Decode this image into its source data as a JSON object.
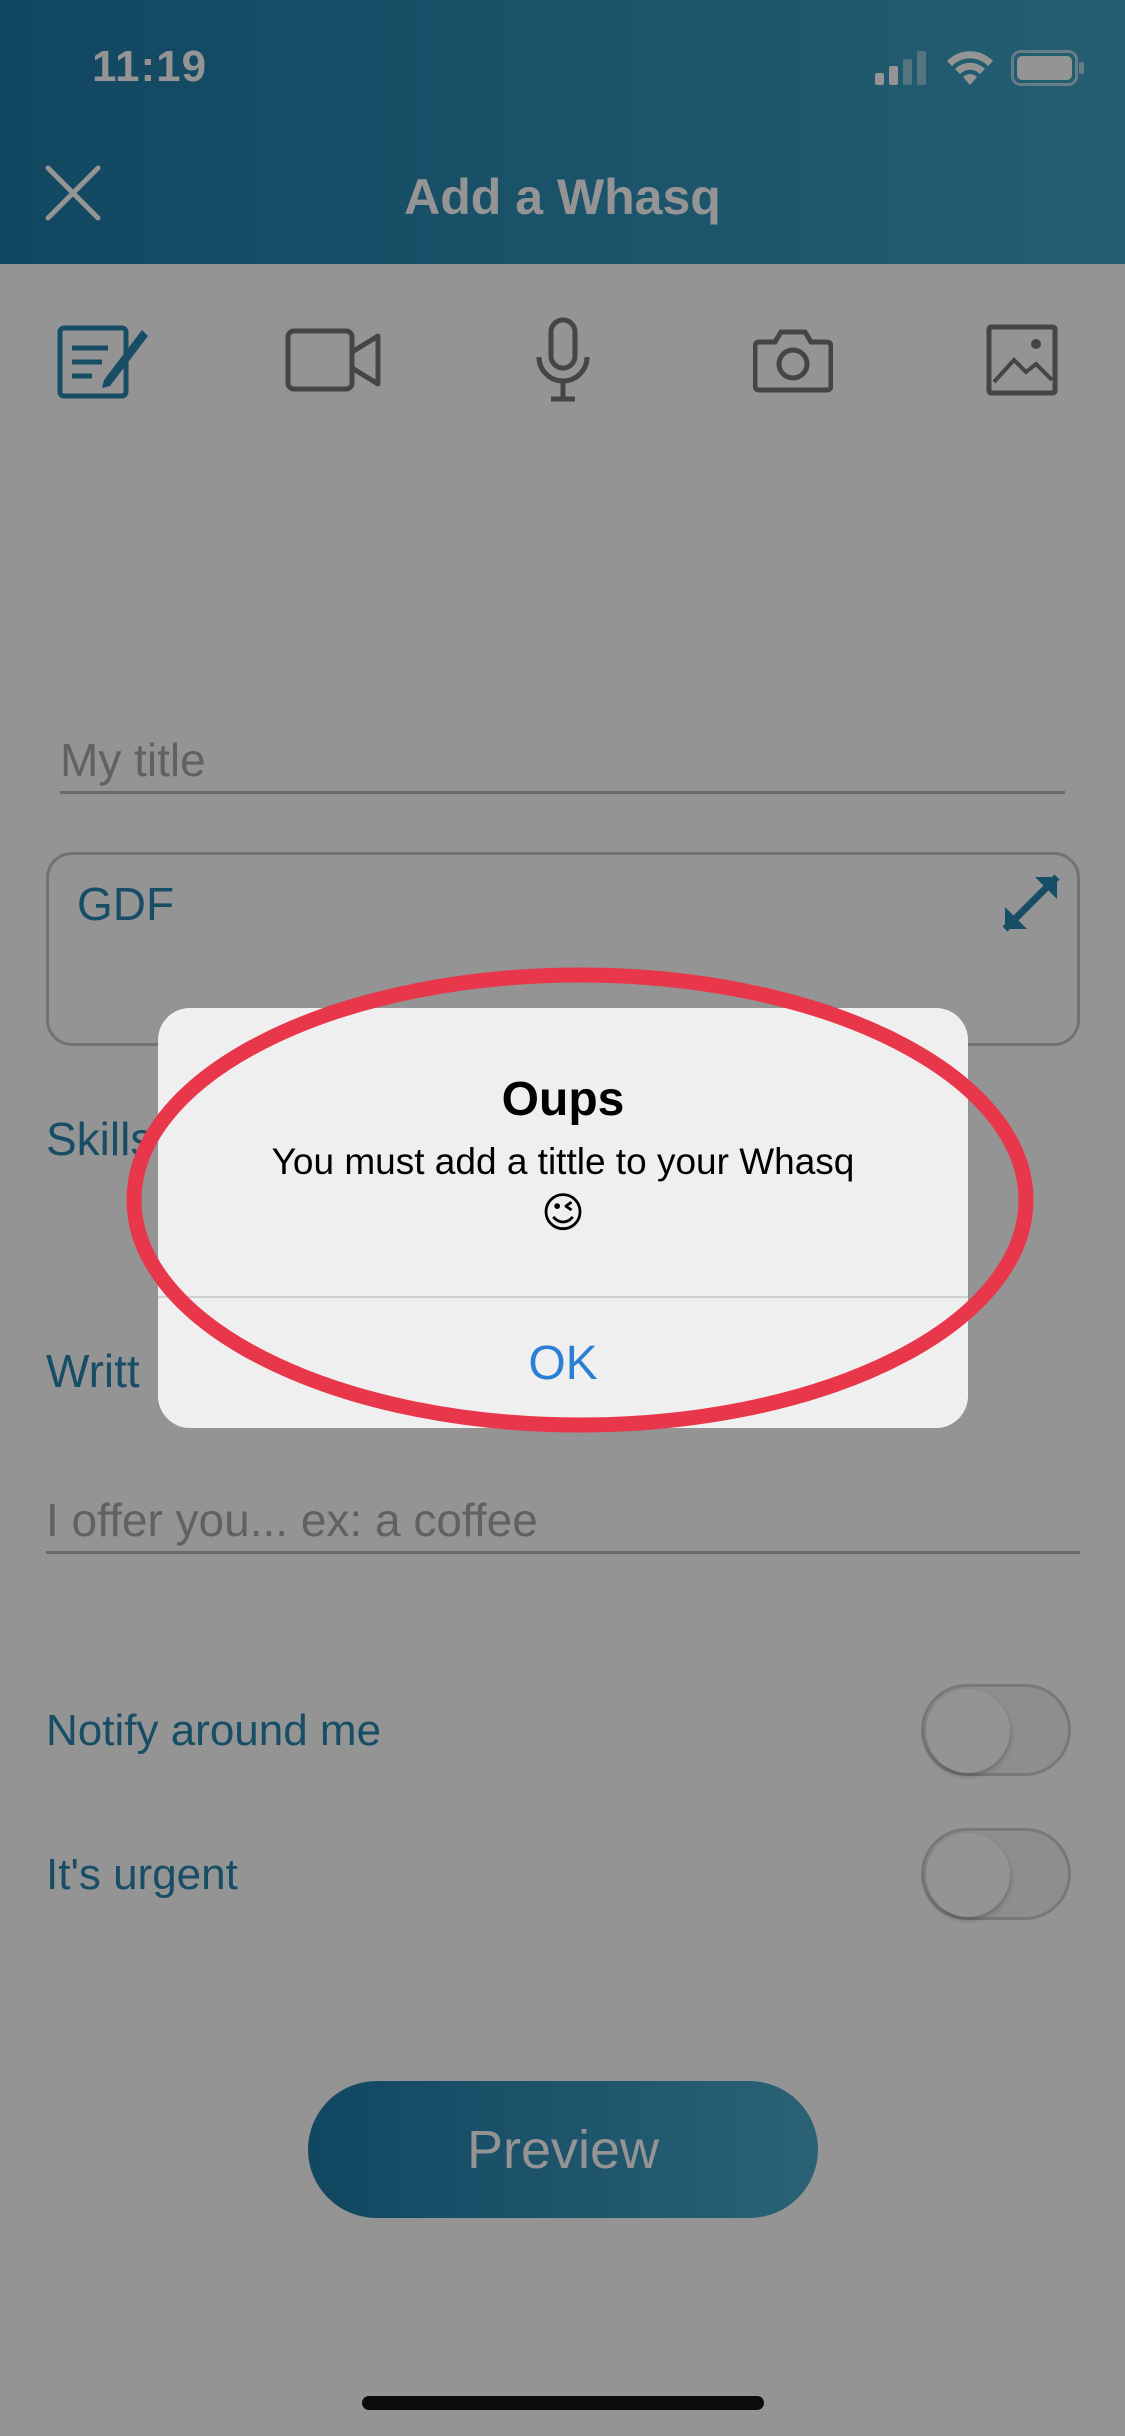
{
  "status_bar": {
    "time": "11:19"
  },
  "header": {
    "title": "Add a Whasq"
  },
  "form": {
    "title_placeholder": "My title",
    "description_value": "GDF",
    "skills_label": "Skills",
    "written_label": "Writt",
    "offer_placeholder": "I offer you... ex: a coffee",
    "notify_label": "Notify around me",
    "urgent_label": "It's urgent",
    "notify_enabled": false,
    "urgent_enabled": false
  },
  "preview_button": {
    "label": "Preview"
  },
  "alert": {
    "title": "Oups",
    "message": "You must add a tittle to your Whasq",
    "emoji": "😉",
    "ok_label": "OK"
  },
  "colors": {
    "accent": "#2a86b0",
    "header_gradient_start": "#1e7aa8",
    "header_gradient_end": "#3fa3c4",
    "highlight_ring": "#e8364a",
    "ok_button": "#2a7fd4"
  },
  "icons": {
    "media": [
      "note-edit-icon",
      "video-icon",
      "microphone-icon",
      "camera-icon",
      "image-icon"
    ],
    "close": "close-icon",
    "expand": "expand-icon"
  }
}
